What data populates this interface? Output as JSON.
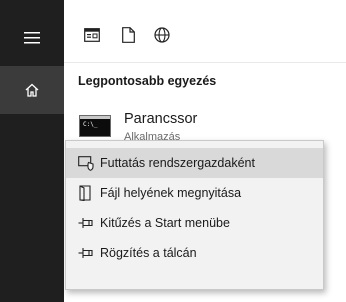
{
  "sidebar": {
    "items": [
      {
        "icon": "hamburger-menu-icon"
      },
      {
        "icon": "home-icon"
      }
    ]
  },
  "toolbar": {
    "icons": [
      "apps-icon",
      "documents-icon",
      "web-icon"
    ]
  },
  "results": {
    "section_title": "Legpontosabb egyezés",
    "best_match": {
      "title": "Parancssor",
      "subtitle": "Alkalmazás",
      "icon": "command-prompt-icon",
      "icon_text": "C:\\_"
    }
  },
  "context_menu": {
    "items": [
      {
        "label": "Futtatás rendszergazdaként",
        "icon": "run-as-admin-icon",
        "highlighted": true
      },
      {
        "label": "Fájl helyének megnyitása",
        "icon": "open-file-location-icon",
        "highlighted": false
      },
      {
        "label": "Kitűzés a Start menübe",
        "icon": "pin-icon",
        "highlighted": false
      },
      {
        "label": "Rögzítés a tálcán",
        "icon": "pin-icon",
        "highlighted": false
      }
    ]
  },
  "colors": {
    "rail": "#1f1f1f",
    "rail_selected": "#3b3b3b",
    "menu_bg": "#f2f2f2",
    "menu_hover": "#d9d9d9"
  }
}
